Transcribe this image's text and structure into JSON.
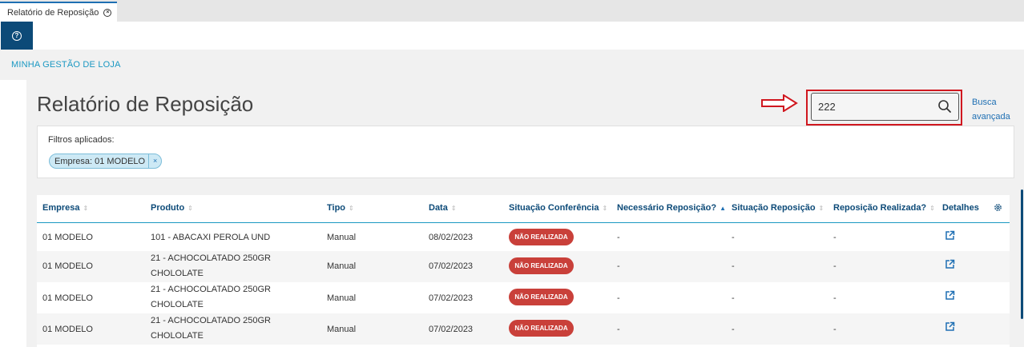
{
  "tab": {
    "label": "Relatório de Reposição",
    "close_symbol": "×"
  },
  "toolbar": {
    "help_symbol": "?"
  },
  "breadcrumb": "MINHA GESTÃO DE LOJA",
  "page_title": "Relatório de Reposição",
  "search": {
    "value": "222",
    "advanced_line1": "Busca",
    "advanced_line2": "avançada"
  },
  "filters": {
    "label": "Filtros aplicados:",
    "chip": "Empresa: 01 MODELO",
    "chip_remove": "×"
  },
  "table": {
    "columns": [
      "Empresa",
      "Produto",
      "Tipo",
      "Data",
      "Situação Conferência",
      "Necessário Reposição?",
      "Situação Reposição",
      "Reposição Realizada?",
      "Detalhes"
    ],
    "sort_symbol": "⇕",
    "active_sort_symbol": "▲",
    "rows": [
      {
        "empresa": "01 MODELO",
        "produto_l1": "101 - ABACAXI PEROLA UND",
        "produto_l2": "",
        "tipo": "Manual",
        "data": "08/02/2023",
        "situacao": "NÃO REALIZADA",
        "necessario": "-",
        "sit_reposicao": "-",
        "realizada": "-"
      },
      {
        "empresa": "01 MODELO",
        "produto_l1": "21 - ACHOCOLATADO 250GR",
        "produto_l2": "CHOLOLATE",
        "tipo": "Manual",
        "data": "07/02/2023",
        "situacao": "NÃO REALIZADA",
        "necessario": "-",
        "sit_reposicao": "-",
        "realizada": "-"
      },
      {
        "empresa": "01 MODELO",
        "produto_l1": "21 - ACHOCOLATADO 250GR",
        "produto_l2": "CHOLOLATE",
        "tipo": "Manual",
        "data": "07/02/2023",
        "situacao": "NÃO REALIZADA",
        "necessario": "-",
        "sit_reposicao": "-",
        "realizada": "-"
      },
      {
        "empresa": "01 MODELO",
        "produto_l1": "21 - ACHOCOLATADO 250GR",
        "produto_l2": "CHOLOLATE",
        "tipo": "Manual",
        "data": "07/02/2023",
        "situacao": "NÃO REALIZADA",
        "necessario": "-",
        "sit_reposicao": "-",
        "realizada": "-"
      }
    ]
  },
  "colors": {
    "primary": "#0c4a78",
    "accent": "#1a98c2",
    "badge": "#c9403a",
    "highlight": "#d0171f"
  }
}
